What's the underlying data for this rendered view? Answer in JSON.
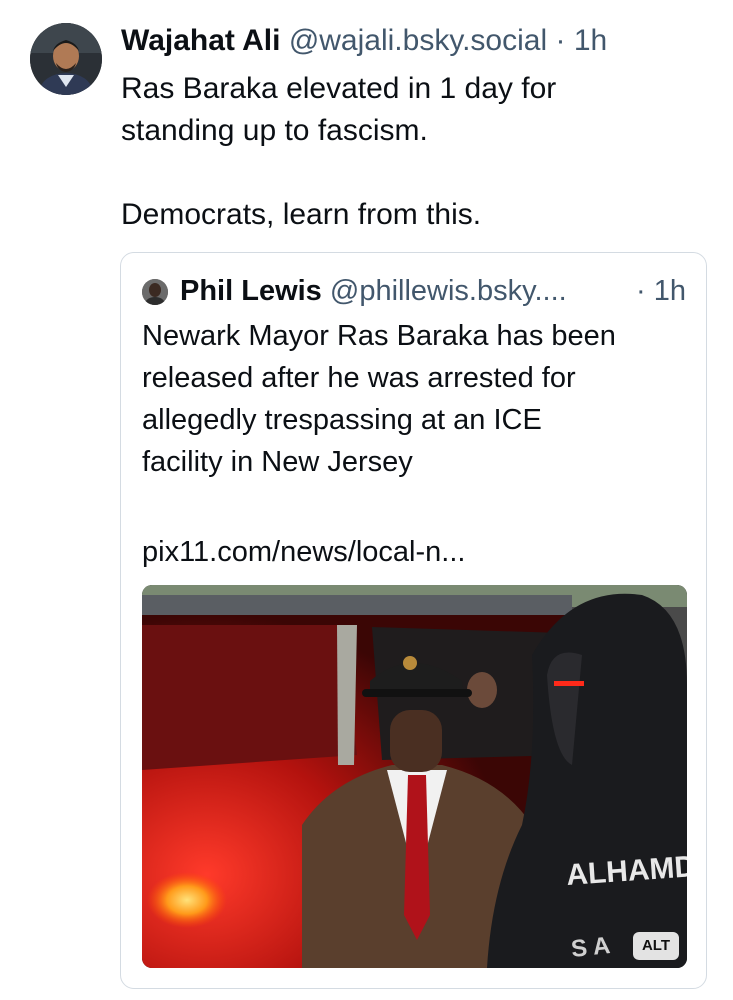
{
  "post": {
    "author_name": "Wajahat Ali",
    "author_handle": "@wajali.bsky.social",
    "separator": "·",
    "time": "1h",
    "text": "Ras Baraka elevated in 1 day for\nstanding up to fascism.\n\nDemocrats, learn from this."
  },
  "quote": {
    "author_name": "Phil Lewis",
    "author_handle": "@phillewis.bsky....",
    "time": "· 1h",
    "text": "Newark Mayor Ras Baraka has been\nreleased after he was arrested for\nallegedly trespassing at an ICE\nfacility in New Jersey",
    "link": "pix11.com/news/local-n...",
    "media": {
      "alt_badge": "ALT",
      "sweatshirt_text_1": "ALHAMDU",
      "sweatshirt_text_2": "S A"
    }
  },
  "colors": {
    "text_primary": "#0b0f14",
    "text_secondary": "#42576c",
    "card_border": "#d4dbe2"
  }
}
